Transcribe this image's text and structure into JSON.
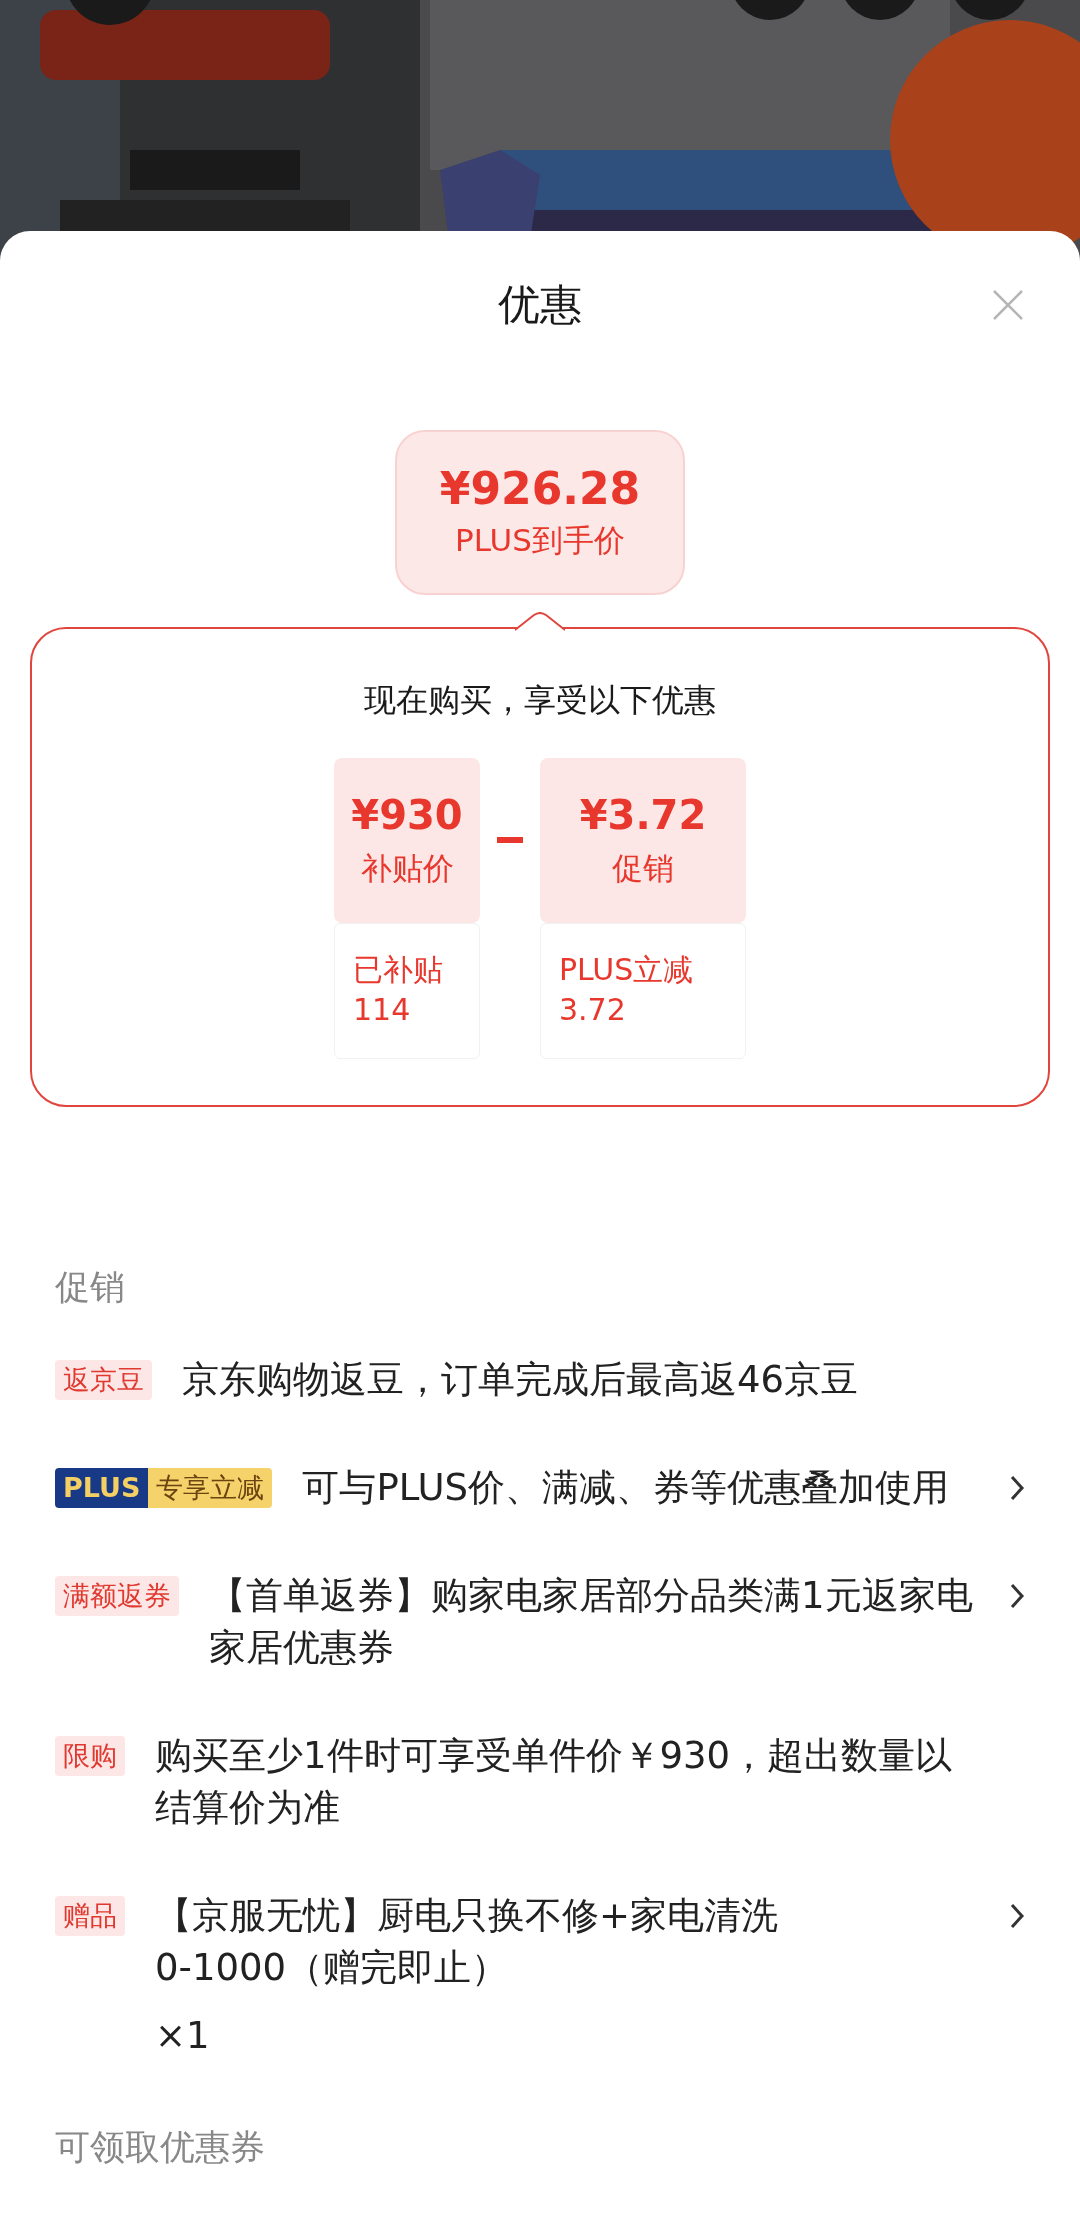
{
  "header": {
    "title": "优惠"
  },
  "final_price": {
    "amount": "¥926.28",
    "label": "PLUS到手价"
  },
  "breakdown": {
    "heading": "现在购买，享受以下优惠",
    "items": [
      {
        "amount": "¥930",
        "label": "补贴价",
        "detail_lines": [
          "已补贴",
          "114"
        ]
      },
      {
        "amount": "¥3.72",
        "label": "促销",
        "detail_lines": [
          "PLUS立减",
          "3.72"
        ]
      }
    ]
  },
  "promotions": {
    "heading": "促销",
    "rows": [
      {
        "kind": "tag",
        "tag": "返京豆",
        "text": "京东购物返豆，订单完成后最高返46京豆",
        "arrow": false
      },
      {
        "kind": "plus",
        "badge": "PLUS",
        "tag": "专享立减",
        "text": "可与PLUS价、满减、券等优惠叠加使用",
        "arrow": true
      },
      {
        "kind": "tag",
        "tag": "满额返券",
        "text": "【首单返券】购家电家居部分品类满1元返家电家居优惠券",
        "arrow": true
      },
      {
        "kind": "tag",
        "tag": "限购",
        "text": "购买至少1件时可享受单件价￥930，超出数量以结算价为准",
        "arrow": false
      },
      {
        "kind": "tag",
        "tag": "赠品",
        "text": "【京服无忧】厨电只换不修+家电清洗\n0-1000（赠完即止）",
        "quantity": "×1",
        "arrow": true
      }
    ]
  },
  "coupons": {
    "heading": "可领取优惠券"
  }
}
